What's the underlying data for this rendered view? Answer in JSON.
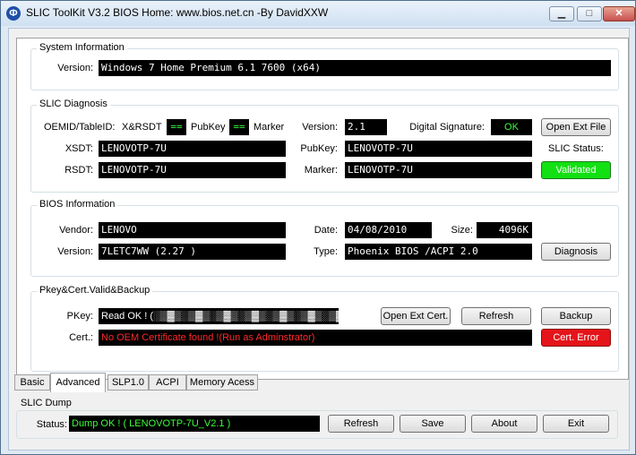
{
  "window": {
    "title": "SLIC ToolKit V3.2     BIOS Home: www.bios.net.cn   -By DavidXXW",
    "minimize": "▁",
    "maximize": "□",
    "close": "✕"
  },
  "system_info": {
    "title": "System Information",
    "version_label": "Version:",
    "version_value": "Windows 7 Home Premium 6.1 7600    (x64)"
  },
  "slic_diag": {
    "title": "SLIC Diagnosis",
    "oemid_label": "OEMID/TableID:",
    "oemid_value": "X&RSDT",
    "oemid_match": "==",
    "pubkey_inline": "PubKey",
    "pubkey_match": "==",
    "marker_inline": "Marker",
    "version_label": "Version:",
    "version_value": "2.1",
    "digsig_label": "Digital Signature:",
    "digsig_value": "OK",
    "open_ext_file": "Open Ext File",
    "xsdt_label": "XSDT:",
    "xsdt_value": "LENOVOTP-7U",
    "rsdt_label": "RSDT:",
    "rsdt_value": "LENOVOTP-7U",
    "pubkey_label": "PubKey:",
    "pubkey_value": "LENOVOTP-7U",
    "marker_label": "Marker:",
    "marker_value": "LENOVOTP-7U",
    "status_label": "SLIC Status:",
    "status_value": "Validated"
  },
  "bios_info": {
    "title": "BIOS Information",
    "vendor_label": "Vendor:",
    "vendor_value": "LENOVO",
    "version_label": "Version:",
    "version_value": "7LETC7WW (2.27 )",
    "date_label": "Date:",
    "date_value": "04/08/2010",
    "size_label": "Size:",
    "size_value": "4096K",
    "type_label": "Type:",
    "type_value": "Phoenix BIOS /ACPI 2.0",
    "diagnosis_button": "Diagnosis"
  },
  "pkey": {
    "title": "Pkey&Cert.Valid&Backup",
    "pkey_label": "PKey:",
    "pkey_value": "Read OK ! (░▒▓▒░▒▓▒░▒▓▒░▒▓▒░▒▓▒░▒▓▒░▒▓*****)",
    "open_ext_cert": "Open Ext Cert.",
    "refresh": "Refresh",
    "backup": "Backup",
    "cert_label": "Cert.:",
    "cert_value": "No OEM Certificate found !(Run as Adminstrator)",
    "cert_error": "Cert. Error"
  },
  "tabs": [
    "Basic",
    "Advanced",
    "SLP1.0",
    "ACPI",
    "Memory Acess"
  ],
  "dump": {
    "title": "SLIC Dump",
    "status_label": "Status:",
    "status_value": "Dump OK !  ( LENOVOTP-7U_V2.1 )",
    "refresh": "Refresh",
    "save": "Save",
    "about": "About",
    "exit": "Exit"
  },
  "colors": {
    "accent_green": "#12e012",
    "error_red": "#e5141a",
    "field_bg": "#000000"
  }
}
